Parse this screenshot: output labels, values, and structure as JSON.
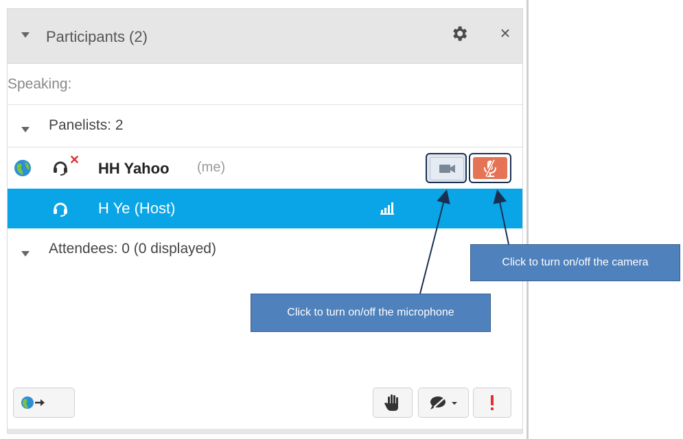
{
  "panel": {
    "title": "Participants (2)",
    "speaking_label": "Speaking:",
    "panelists_label": "Panelists: 2",
    "attendees_label": "Attendees: 0 (0 displayed)"
  },
  "participants": [
    {
      "name": "HH Yahoo",
      "suffix": "(me)"
    },
    {
      "name": "H Ye (Host)"
    }
  ],
  "icons": {
    "collapse": "triangle-down-icon",
    "settings": "gear-icon",
    "close": "close-icon",
    "globe": "globe-icon",
    "headset": "headset-icon",
    "muted": "muted-x-icon",
    "camera": "camera-icon",
    "mic_muted": "mic-muted-icon",
    "signal": "signal-bars-icon",
    "raise_hand": "hand-icon",
    "chat": "chat-icon",
    "alert": "exclamation-icon",
    "share": "share-icon"
  },
  "callouts": {
    "camera": "Click to turn on/off the camera",
    "microphone": "Click to turn on/off the microphone"
  },
  "colors": {
    "selected_row": "#0aa5e6",
    "mic_muted_bg": "#e57355",
    "callout_bg": "#4f81bd",
    "mute_x": "#e03131"
  }
}
